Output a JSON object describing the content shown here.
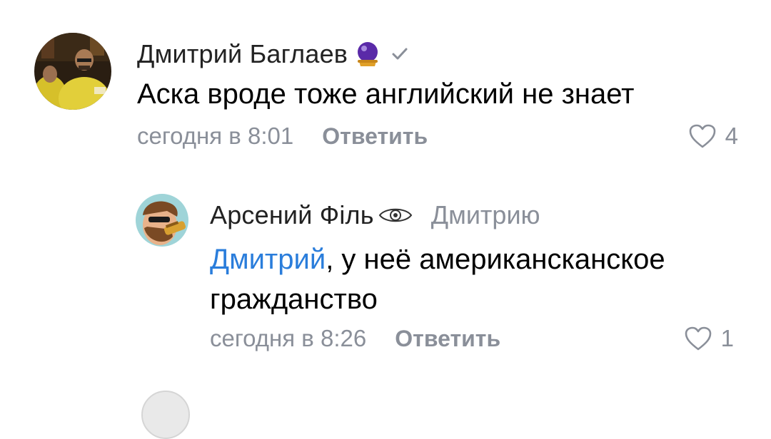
{
  "comments": [
    {
      "author": "Дмитрий Баглаев",
      "badge_icon": "crystal-ball-icon",
      "verified_icon": "check-icon",
      "text": "Аска вроде тоже английский не знает",
      "time": "сегодня в 8:01",
      "reply_label": "Ответить",
      "likes": "4"
    },
    {
      "author": "Арсений Фiль",
      "badge_icon": "eye-icon",
      "reply_to": "Дмитрию",
      "mention": "Дмитрий",
      "text_rest": ", у неё американсканское гражданство",
      "time": "сегодня в 8:26",
      "reply_label": "Ответить",
      "likes": "1"
    }
  ],
  "colors": {
    "accent_link": "#2a7ddb",
    "muted_text": "#8a8f99"
  }
}
